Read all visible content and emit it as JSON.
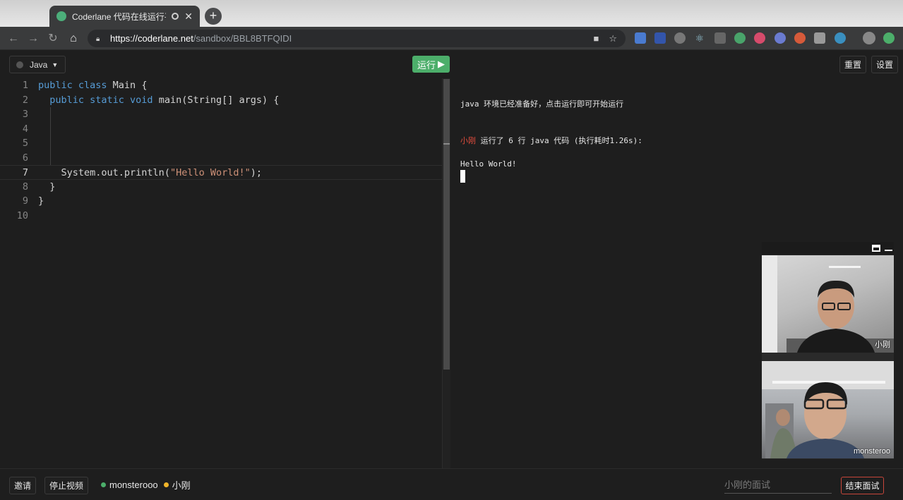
{
  "browser": {
    "tab_title": "Coderlane 代码在线运行平",
    "url_host": "https://coderlane.net",
    "url_path": "/sandbox/BBL8BTFQIDI"
  },
  "toolbar": {
    "language": "Java",
    "run_label": "运行",
    "reset_label": "重置",
    "settings_label": "设置"
  },
  "editor": {
    "line_numbers": [
      "1",
      "2",
      "3",
      "4",
      "5",
      "6",
      "7",
      "8",
      "9",
      "10"
    ],
    "lines": [
      {
        "kw": "public class",
        "rest": " Main {"
      },
      {
        "indent": "  ",
        "kw": "public static void",
        "rest": " main(String[] args) {"
      },
      {
        "rest": ""
      },
      {
        "rest": ""
      },
      {
        "rest": ""
      },
      {
        "rest": ""
      },
      {
        "indent": "    ",
        "pre": "System.out.println(",
        "str": "\"Hello World!\"",
        "post": ");"
      },
      {
        "rest": "  }"
      },
      {
        "rest": "}"
      },
      {
        "rest": ""
      }
    ],
    "active_line": 7
  },
  "console": {
    "ready_msg": "java 环境已经准备好，点击运行即可开始运行",
    "run_user": "小刚",
    "run_msg": " 运行了 6 行 java 代码 (执行耗时1.26s):",
    "output": "Hello World!"
  },
  "video": {
    "participants": [
      {
        "name": "小刚"
      },
      {
        "name": "monsteroo"
      }
    ]
  },
  "bottom": {
    "invite_label": "邀请",
    "stop_video_label": "停止视频",
    "users": [
      {
        "name": "monsterooo",
        "color": "#4cae6a"
      },
      {
        "name": "小刚",
        "color": "#f0b429"
      }
    ],
    "interview_placeholder": "小刚的面试",
    "end_label": "结束面试"
  }
}
